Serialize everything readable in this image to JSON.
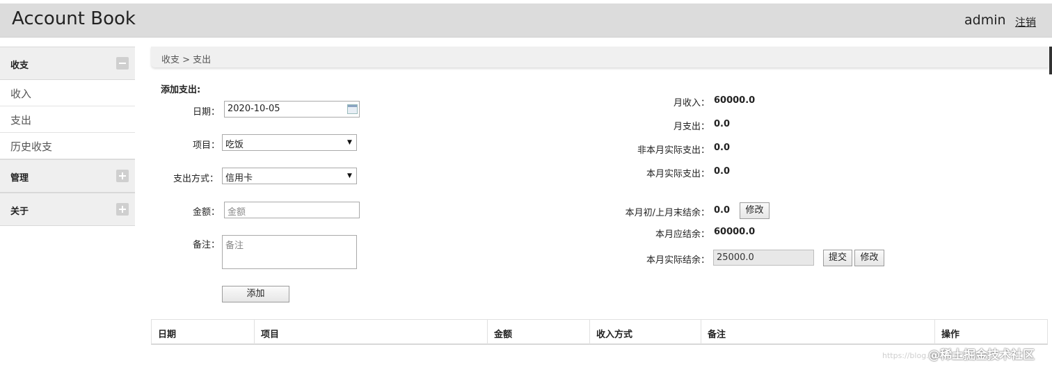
{
  "header": {
    "title": "Account Book",
    "user": "admin",
    "logout": "注销"
  },
  "sidebar": {
    "groups": [
      {
        "label": "收支",
        "expanded": true,
        "items": [
          "收入",
          "支出",
          "历史收支"
        ]
      },
      {
        "label": "管理",
        "expanded": false
      },
      {
        "label": "关于",
        "expanded": false
      }
    ]
  },
  "breadcrumb": "收支 > 支出",
  "form": {
    "title": "添加支出:",
    "date_label": "日期：",
    "date_value": "2020-10-05",
    "item_label": "项目：",
    "item_value": "吃饭",
    "method_label": "支出方式：",
    "method_value": "信用卡",
    "amount_label": "金额：",
    "amount_placeholder": "金额",
    "note_label": "备注：",
    "note_placeholder": "备注",
    "add_button": "添加"
  },
  "summary": {
    "month_income_label": "月收入：",
    "month_income": "60000.0",
    "month_expense_label": "月支出：",
    "month_expense": "0.0",
    "non_month_actual_label": "非本月实际支出：",
    "non_month_actual": "0.0",
    "month_actual_label": "本月实际支出：",
    "month_actual": "0.0",
    "opening_label": "本月初/上月末结余：",
    "opening": "0.0",
    "modify_button": "修改",
    "expected_label": "本月应结余：",
    "expected": "60000.0",
    "actual_balance_label": "本月实际结余：",
    "actual_balance": "25000.0",
    "submit_button": "提交",
    "modify_button_2": "修改"
  },
  "table": {
    "columns": [
      "日期",
      "项目",
      "金额",
      "收入方式",
      "备注",
      "操作"
    ]
  },
  "watermark": {
    "url": "https://blog.csdn.net/weixin_...",
    "brand": "@稀土掘金技术社区"
  },
  "colors": {
    "header_bg": "#dcdcdc",
    "sidebar_group_bg": "#efefef"
  }
}
